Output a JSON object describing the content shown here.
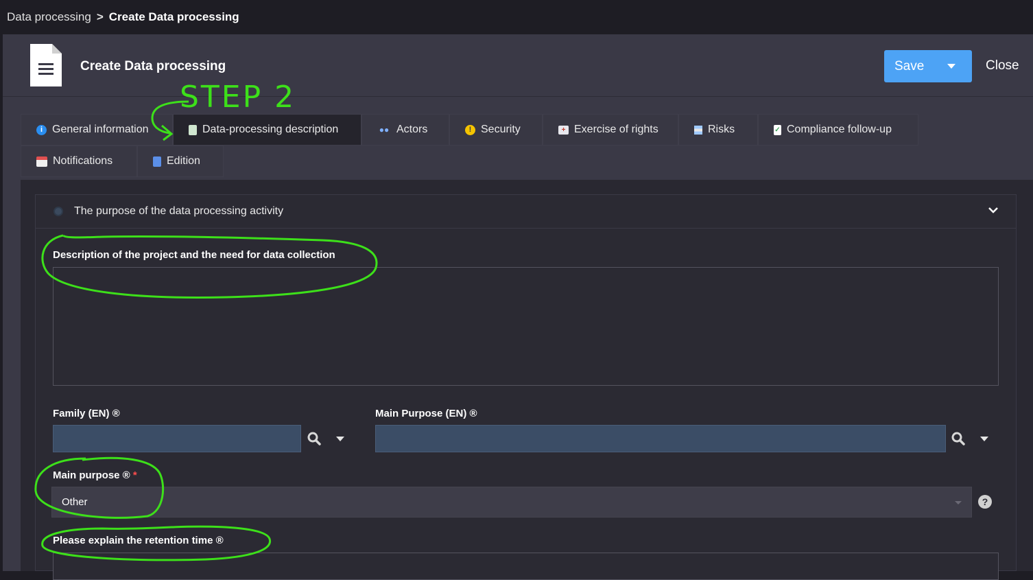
{
  "breadcrumb": {
    "parent": "Data processing",
    "separator": ">",
    "current": "Create Data processing"
  },
  "header": {
    "title": "Create Data processing",
    "save_label": "Save",
    "close_label": "Close"
  },
  "tabs": [
    {
      "label": "General information",
      "icon": "info-circle-icon"
    },
    {
      "label": "Data-processing description",
      "icon": "document-icon",
      "active": true
    },
    {
      "label": "Actors",
      "icon": "people-icon"
    },
    {
      "label": "Security",
      "icon": "warning-icon"
    },
    {
      "label": "Exercise of rights",
      "icon": "medical-case-icon"
    },
    {
      "label": "Risks",
      "icon": "stack-icon"
    },
    {
      "label": "Compliance follow-up",
      "icon": "clipboard-check-icon"
    },
    {
      "label": "Notifications",
      "icon": "calendar-icon"
    },
    {
      "label": "Edition",
      "icon": "file-icon"
    }
  ],
  "section": {
    "title": "The purpose of the data processing activity",
    "fields": {
      "description": {
        "label": "Description of the project and the need for data collection",
        "value": ""
      },
      "family": {
        "label": "Family (EN) ®",
        "value": ""
      },
      "main_purpose_en": {
        "label": "Main Purpose (EN) ®",
        "value": ""
      },
      "main_purpose": {
        "label": "Main purpose ®",
        "required_mark": "*",
        "value": "Other"
      },
      "retention": {
        "label": "Please explain the retention time ®"
      }
    }
  },
  "annotation": {
    "step_text": "STEP 2",
    "color": "#3de01a"
  },
  "colors": {
    "accent": "#4da3f5",
    "background": "#3a3946",
    "annotation": "#3de01a"
  }
}
